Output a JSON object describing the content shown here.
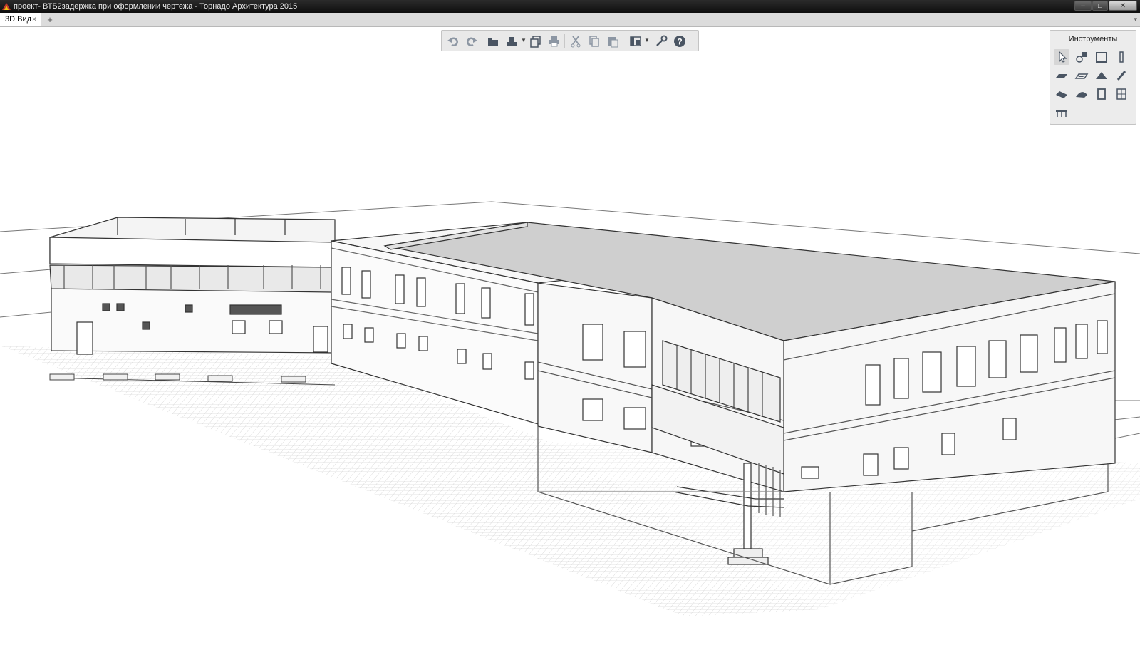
{
  "window": {
    "title": "проект- ВТБ2задержка при оформлении чертежа - Торнадо Архитектура 2015",
    "app_icon": "tornado-app-icon",
    "buttons": [
      "minimize-icon",
      "maximize-icon",
      "close-icon"
    ]
  },
  "tabs": {
    "items": [
      {
        "label": "3D Вид",
        "close": "×"
      }
    ],
    "add": "+",
    "menu": "▾"
  },
  "toolbar": {
    "icons": [
      "undo-icon",
      "redo-icon",
      "open-folder-icon",
      "save-icon",
      "export-icon",
      "print-icon",
      "cut-icon",
      "copy-icon",
      "paste-icon",
      "view-settings-icon",
      "settings-wrench-icon",
      "help-icon"
    ]
  },
  "tools_panel": {
    "title": "Инструменты",
    "items": [
      "select-arrow-icon",
      "shape-icon",
      "wall-icon",
      "column-icon",
      "slab-icon",
      "floor-icon",
      "roof-icon",
      "railing-icon",
      "beam-icon",
      "shell-icon",
      "door-icon",
      "window-icon",
      "stair-icon"
    ]
  },
  "viewport": {
    "content": "3d-building-model"
  },
  "colors": {
    "titlebar": "#1a1a1a",
    "toolbar_bg": "#e9e9e9",
    "icon": "#4a5563",
    "model_line": "#3a3a3a"
  }
}
